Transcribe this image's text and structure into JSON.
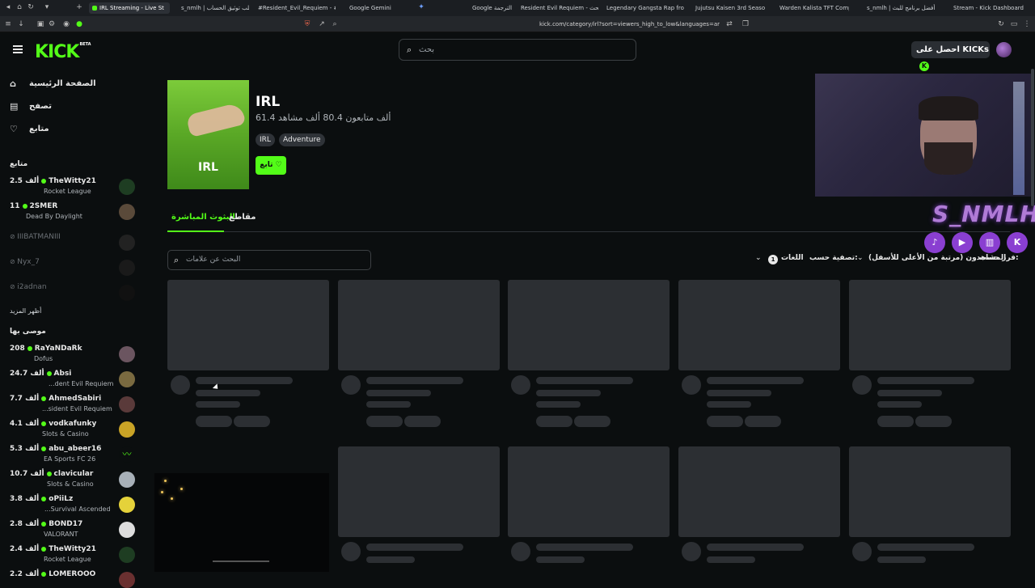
{
  "browser": {
    "tabs": [
      {
        "label": "IRL Streaming - Live St",
        "active": true
      },
      {
        "label": "s_nmlh | طلب توثيق الحساب"
      },
      {
        "label": "#Resident_Evil_Requiem - #"
      },
      {
        "label": "Google Gemini"
      },
      {
        "label": "Google الترجمة"
      },
      {
        "label": "Resident Evil Requiem - بحث"
      },
      {
        "label": "Legendary Gangsta Rap from"
      },
      {
        "label": "Jujutsu Kaisen 3rd Season انمي"
      },
      {
        "label": "Warden Kalista TFT Comp Guid"
      },
      {
        "label": "s_nmlh | أفضل برنامج للبث"
      },
      {
        "label": "Stream - Kick Dashboard"
      }
    ],
    "url": "kick.com/category/irl?sort=viewers_high_to_low&languages=ar"
  },
  "header": {
    "logo": "KICK",
    "logo_badge": "BETA",
    "search_placeholder": "بحث",
    "kicks_button": "احصل على KICKs"
  },
  "sidebar": {
    "nav": [
      {
        "label": "الصفحة الرئيسية",
        "icon": "home-icon"
      },
      {
        "label": "تصفح",
        "icon": "browse-icon"
      },
      {
        "label": "متابع",
        "icon": "heart-icon"
      }
    ],
    "following_title": "متابع",
    "following": [
      {
        "viewers": "2.5 ألف",
        "name": "TheWitty21",
        "category": "Rocket League",
        "live": true
      },
      {
        "viewers": "11",
        "name": "2SMER",
        "category": "Dead By Daylight",
        "live": true
      },
      {
        "viewers": "",
        "name": "IIIBATMANIII",
        "category": "",
        "live": false
      },
      {
        "viewers": "",
        "name": "Nyx_7",
        "category": "",
        "live": false
      },
      {
        "viewers": "",
        "name": "i2adnan",
        "category": "",
        "live": false
      }
    ],
    "show_more": "أظهر المزيد",
    "recommended_title": "موصى بها",
    "recommended": [
      {
        "viewers": "208",
        "name": "RaYaNDaRk",
        "category": "Dofus"
      },
      {
        "viewers": "24.7 ألف",
        "name": "Absi",
        "category": "...dent Evil Requiem"
      },
      {
        "viewers": "7.7 ألف",
        "name": "AhmedSabiri",
        "category": "...sident Evil Requiem"
      },
      {
        "viewers": "4.1 ألف",
        "name": "vodkafunky",
        "category": "Slots & Casino"
      },
      {
        "viewers": "5.3 ألف",
        "name": "abu_abeer16",
        "category": "EA Sports FC 26"
      },
      {
        "viewers": "10.7 ألف",
        "name": "clavicular",
        "category": "Slots & Casino"
      },
      {
        "viewers": "3.8 ألف",
        "name": "oPiiLz",
        "category": "...Survival Ascended"
      },
      {
        "viewers": "2.8 ألف",
        "name": "BOND17",
        "category": "VALORANT"
      },
      {
        "viewers": "2.4 ألف",
        "name": "TheWitty21",
        "category": "Rocket League"
      },
      {
        "viewers": "2.2 ألف",
        "name": "LOMEROOO",
        "category": ""
      }
    ]
  },
  "category": {
    "title": "IRL",
    "image_text": "IRL",
    "stats": "ألف متابعون 80.4  ألف مشاهد 61.4",
    "tags": [
      "IRL",
      "Adventure"
    ],
    "follow_button": "تابع"
  },
  "tabs": {
    "live": "البثوث المباشرة",
    "clips": "مقاطع"
  },
  "filters": {
    "tag_search_placeholder": "البحث عن علامات",
    "sort_label": "فرز حسب:",
    "sort_value": "المشاهدون (مرتبة من الأعلى للأسفل)",
    "filter_label": "تصفية حسب:",
    "languages_label": "اللغات",
    "languages_count": "1"
  },
  "overlay": {
    "streamer_name": "S_NMLH",
    "socials": [
      "tiktok-icon",
      "youtube-icon",
      "twitch-icon",
      "kick-icon"
    ]
  },
  "colors": {
    "accent": "#53fc18",
    "background": "#0b0e0f",
    "skeleton": "#2c2f33",
    "overlay_purple": "#8a3fd1"
  }
}
